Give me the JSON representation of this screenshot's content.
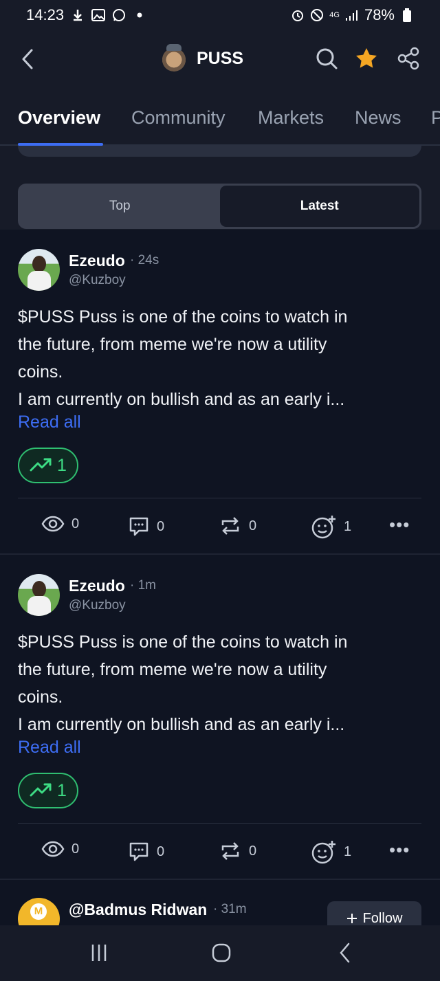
{
  "status_bar": {
    "time": "14:23",
    "battery": "78%",
    "network": "4G"
  },
  "header": {
    "title": "PUSS"
  },
  "tabs": [
    {
      "label": "Overview",
      "active": true
    },
    {
      "label": "Community",
      "active": false
    },
    {
      "label": "Markets",
      "active": false
    },
    {
      "label": "News",
      "active": false
    },
    {
      "label": "P",
      "active": false
    }
  ],
  "segmented": {
    "top": "Top",
    "latest": "Latest",
    "selected": "Latest"
  },
  "posts": [
    {
      "author": "Ezeudo",
      "time": "· 24s",
      "handle": "@Kuzboy",
      "lines": [
        "$PUSS Puss is one of the coins to watch in",
        "the future, from meme we're now a utility",
        "coins.",
        "I am currently on bullish and as an early i..."
      ],
      "read_all": "Read all",
      "bullish_count": "1",
      "views": "0",
      "comments": "0",
      "reposts": "0",
      "reactions": "1"
    },
    {
      "author": "Ezeudo",
      "time": "· 1m",
      "handle": "@Kuzboy",
      "lines": [
        "$PUSS Puss is one of the coins to watch in",
        "the future, from meme we're now a utility",
        "coins.",
        "I am currently on bullish and as an early i..."
      ],
      "read_all": "Read all",
      "bullish_count": "1",
      "views": "0",
      "comments": "0",
      "reposts": "0",
      "reactions": "1"
    },
    {
      "author": "@Badmus Ridwan",
      "time": "· 31m",
      "follow_label": "Follow"
    }
  ],
  "colors": {
    "accent": "#3d6df3",
    "bullish": "#2fbf71",
    "star": "#f5a623",
    "background": "#0f1422"
  }
}
